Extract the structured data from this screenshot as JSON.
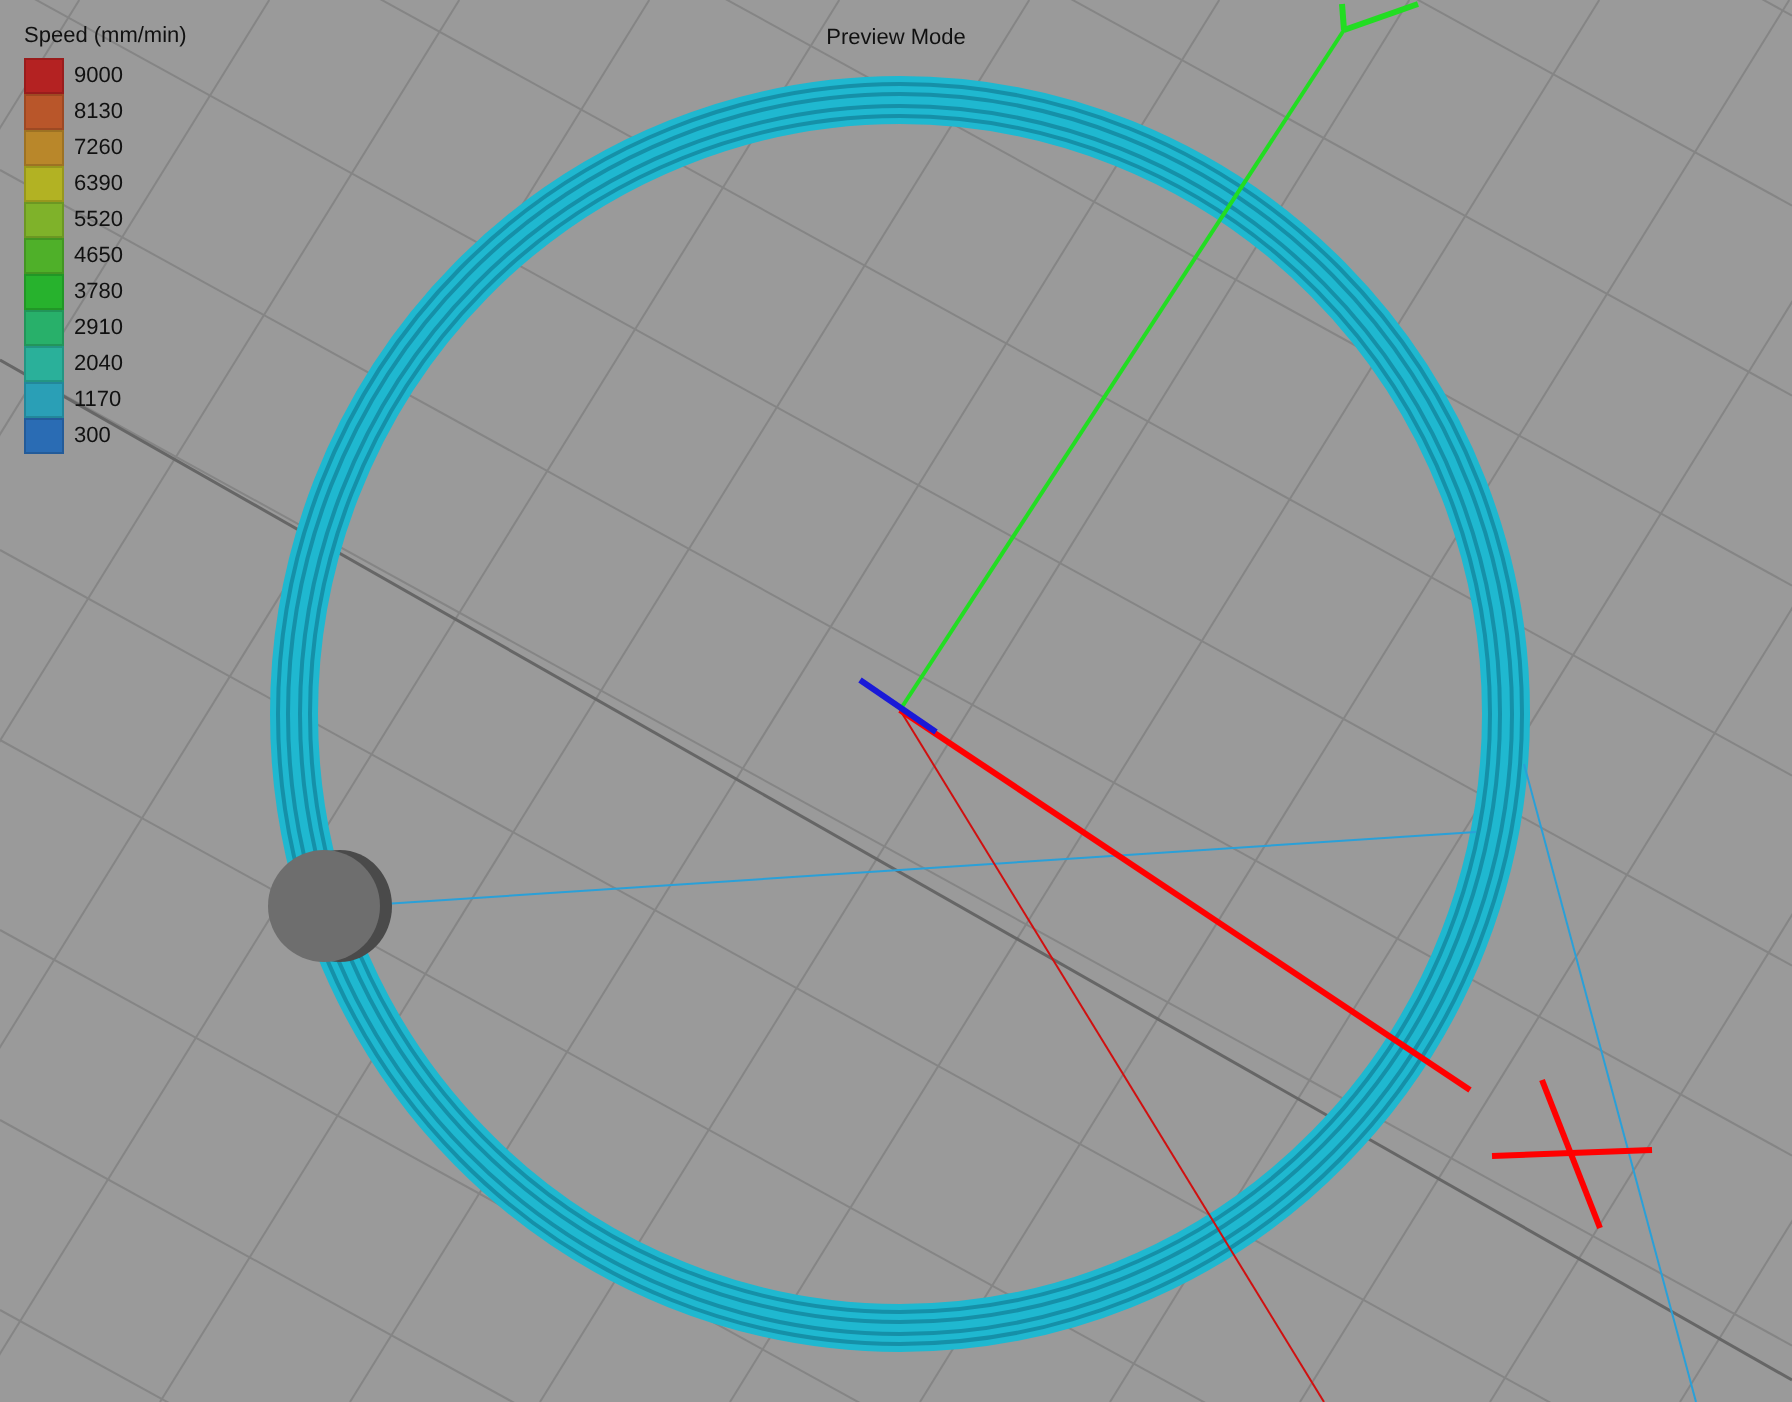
{
  "viewport": {
    "title": "Preview Mode"
  },
  "legend": {
    "title": "Speed (mm/min)",
    "items": [
      {
        "label": "9000",
        "color": "#b42222"
      },
      {
        "label": "8130",
        "color": "#b9562a"
      },
      {
        "label": "7260",
        "color": "#b9872a"
      },
      {
        "label": "6390",
        "color": "#b2b223"
      },
      {
        "label": "5520",
        "color": "#7fb22a"
      },
      {
        "label": "4650",
        "color": "#4fb029"
      },
      {
        "label": "3780",
        "color": "#27b22d"
      },
      {
        "label": "2910",
        "color": "#28b06a"
      },
      {
        "label": "2040",
        "color": "#2ab09a"
      },
      {
        "label": "1170",
        "color": "#2a9fb6"
      },
      {
        "label": "300",
        "color": "#2a6cb4"
      }
    ]
  }
}
